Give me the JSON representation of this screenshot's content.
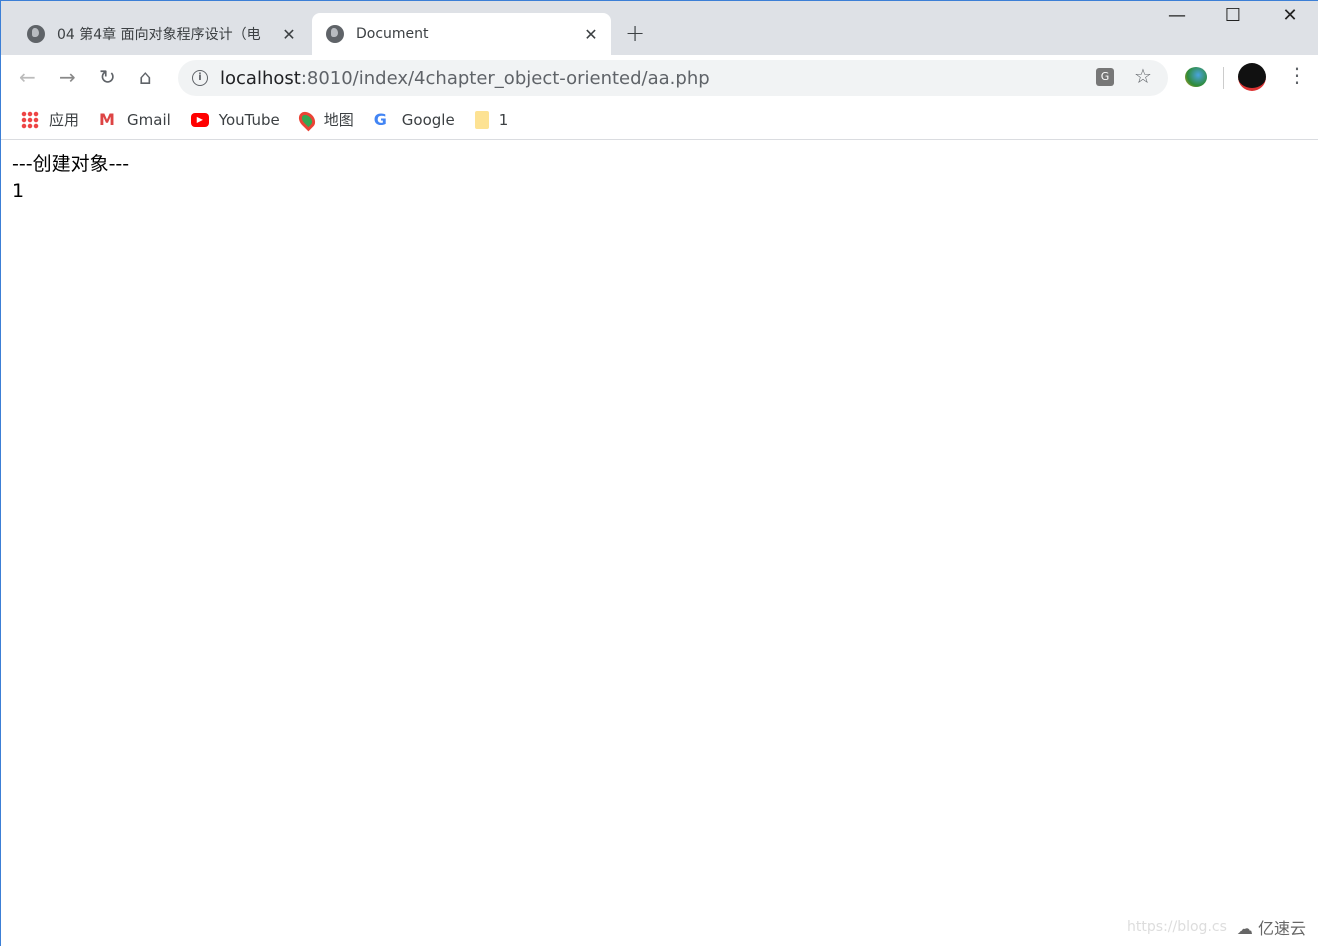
{
  "tabs": [
    {
      "title": "04 第4章 面向对象程序设计（电",
      "active": false
    },
    {
      "title": "Document",
      "active": true
    }
  ],
  "window_controls": {
    "minimize": "—",
    "maximize": "☐",
    "close": "✕"
  },
  "address_bar": {
    "host": "localhost",
    "path": ":8010/index/4chapter_object-oriented/aa.php"
  },
  "bookmarks": [
    {
      "label": "应用",
      "icon": "apps-grid-icon"
    },
    {
      "label": "Gmail",
      "icon": "gmail-icon"
    },
    {
      "label": "YouTube",
      "icon": "youtube-icon"
    },
    {
      "label": "地图",
      "icon": "maps-pin-icon"
    },
    {
      "label": "Google",
      "icon": "google-g-icon"
    },
    {
      "label": "1",
      "icon": "folder-icon"
    }
  ],
  "page": {
    "lines": [
      "---创建对象---",
      "1"
    ]
  },
  "watermark": {
    "url": "https://blog.cs",
    "brand": "亿速云"
  }
}
